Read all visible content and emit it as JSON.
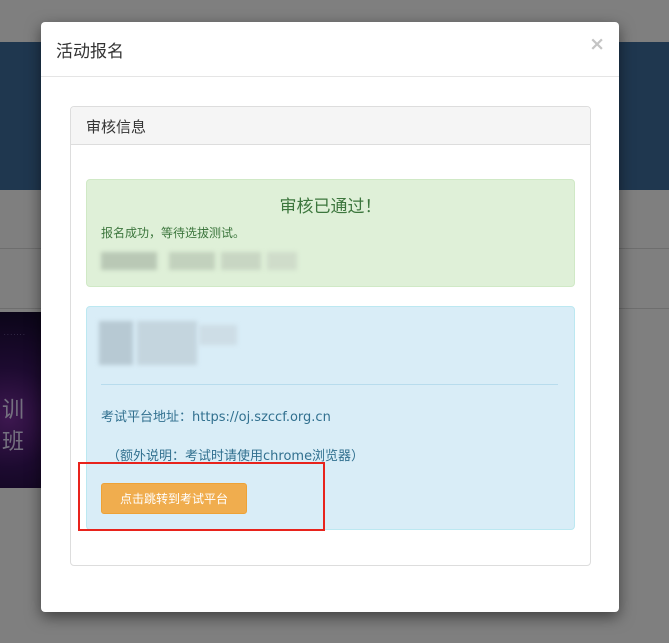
{
  "modal": {
    "title": "活动报名",
    "close_glyph": "×"
  },
  "panel": {
    "title": "审核信息"
  },
  "success": {
    "heading": "审核已通过！",
    "message": "报名成功，等待选拔测试。"
  },
  "info": {
    "platform_label": "考试平台地址：",
    "platform_url": "https://oj.szccf.org.cn",
    "note": "（额外说明：考试时请使用chrome浏览器）",
    "jump_button": "点击跳转到考试平台"
  },
  "background": {
    "thumb_text": "训班"
  },
  "colors": {
    "success_bg": "#dff0d8",
    "success_text": "#3c763d",
    "info_bg": "#d9edf7",
    "info_text": "#31708f",
    "button_bg": "#f0ad4e",
    "annotation": "#e8231c"
  }
}
